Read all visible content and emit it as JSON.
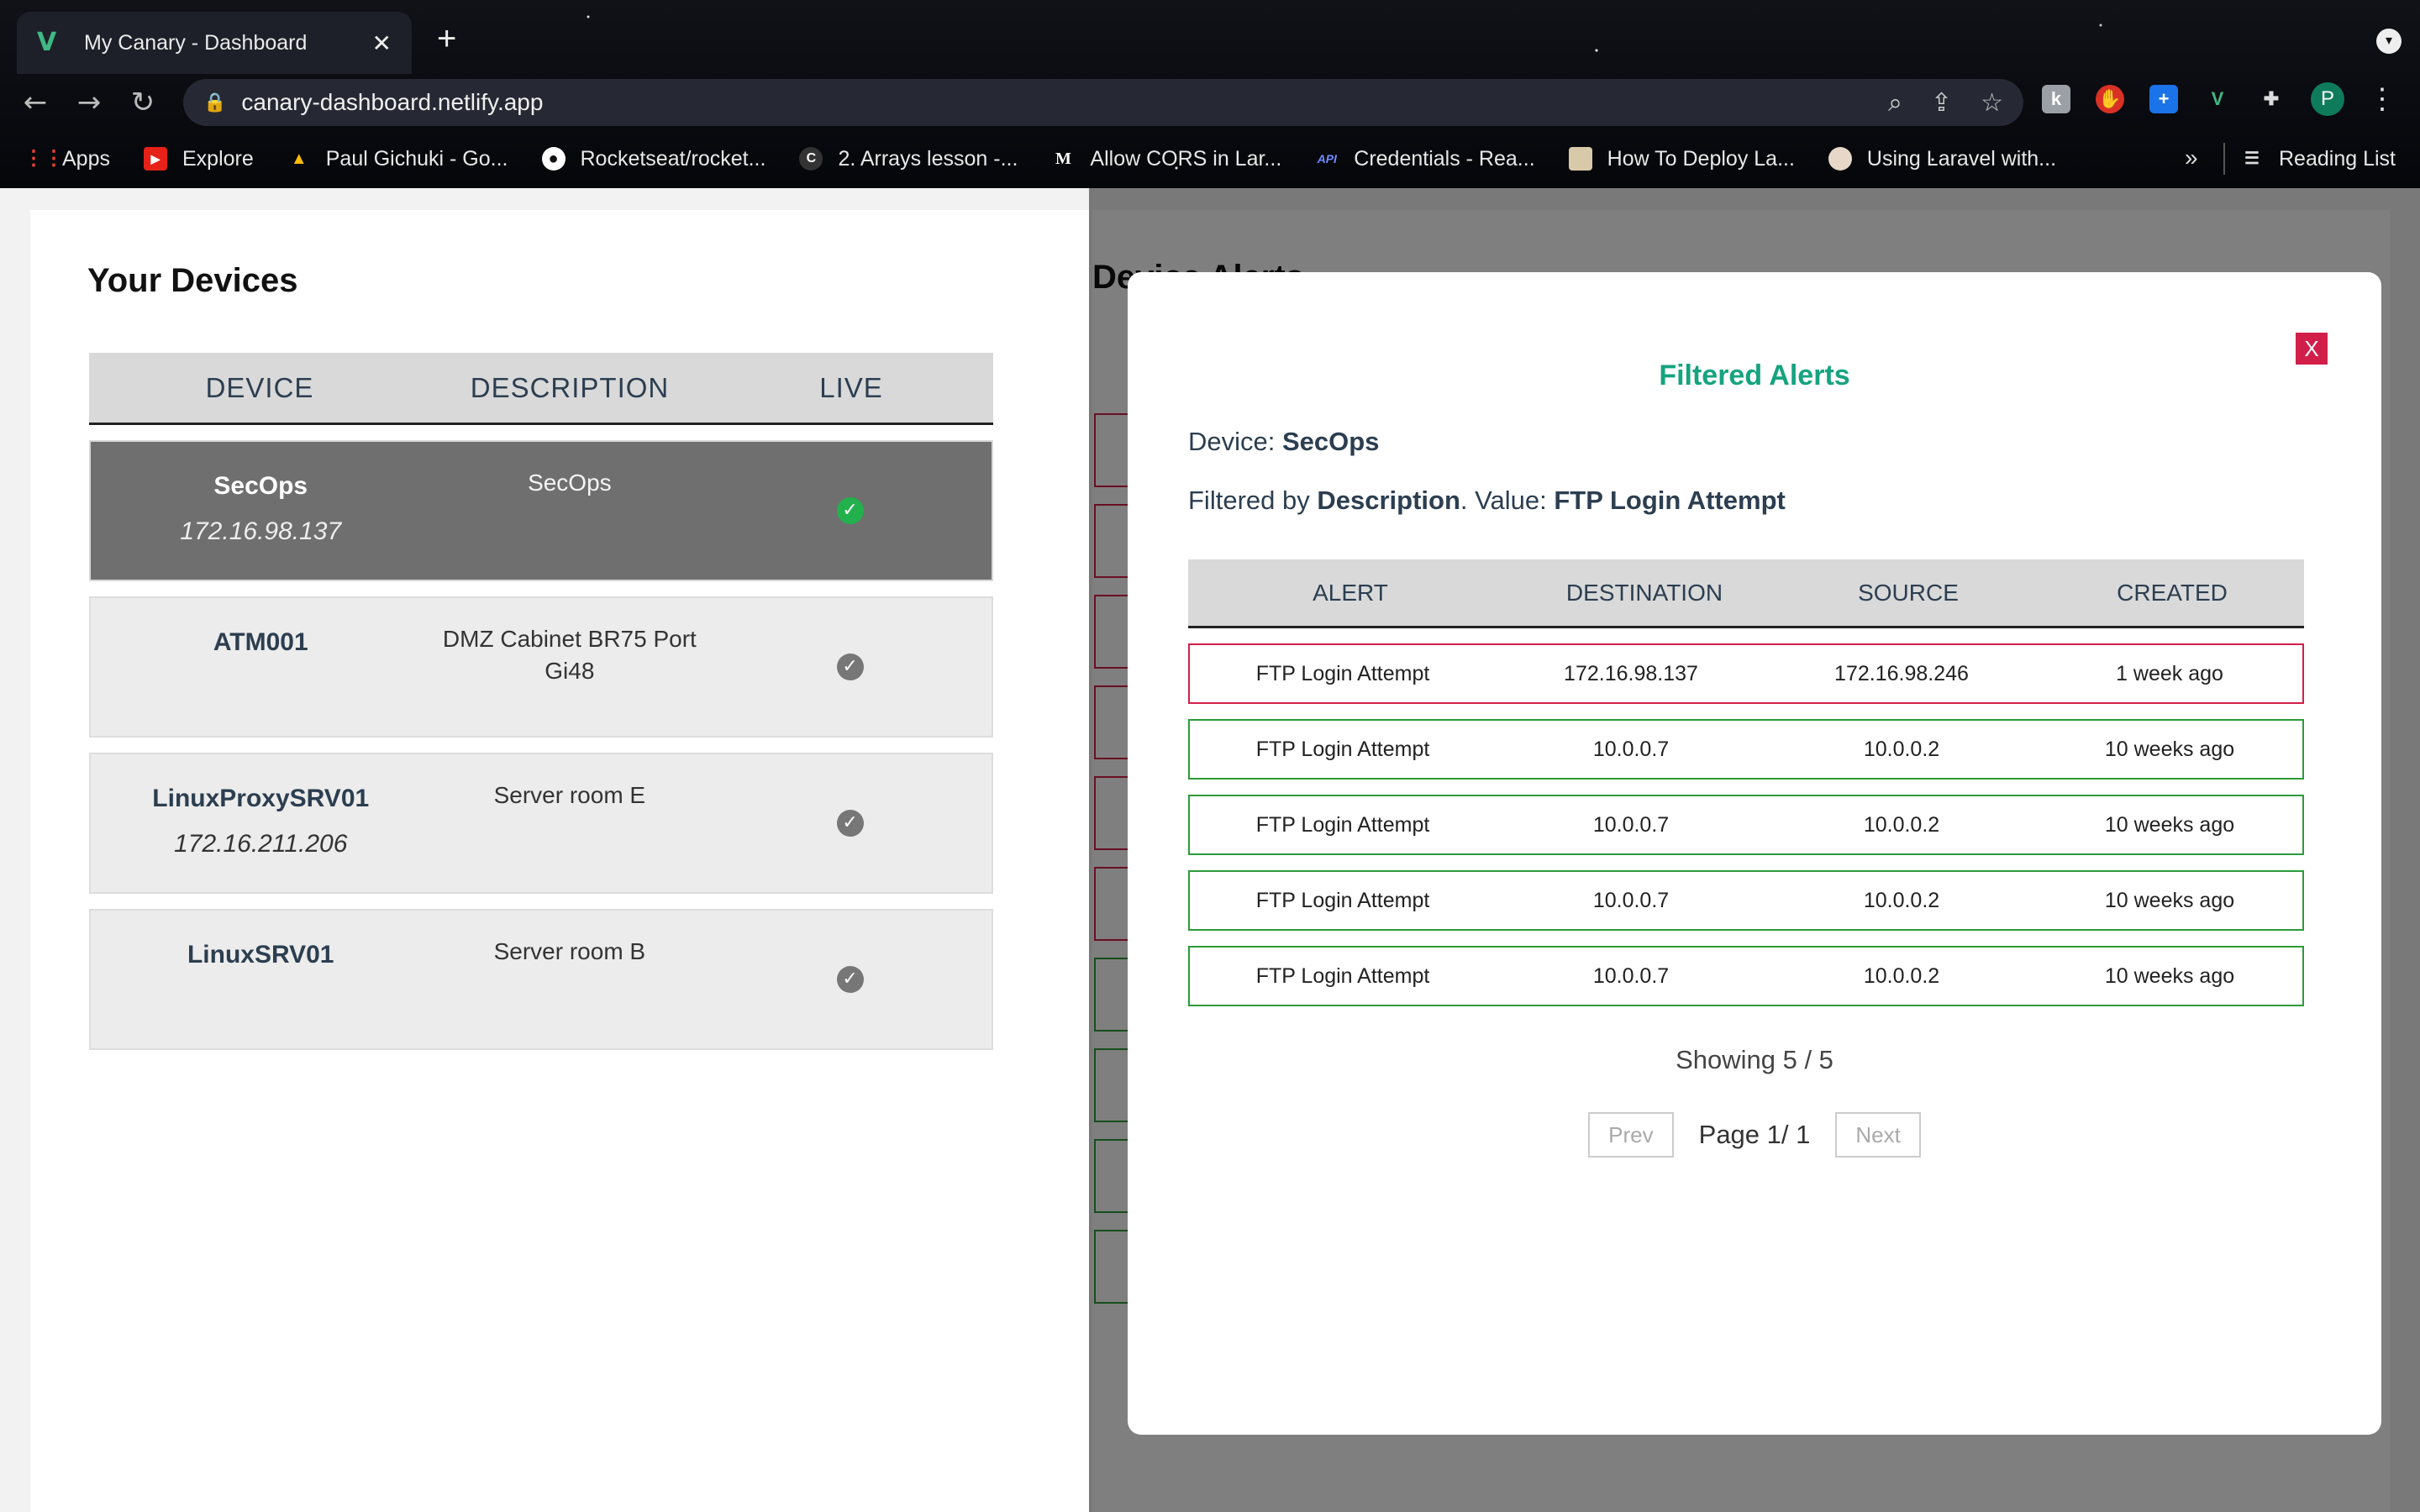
{
  "browser": {
    "tab_title": "My Canary - Dashboard",
    "tab_close": "✕",
    "new_tab": "+",
    "url": "canary-dashboard.netlify.app",
    "profile_initial": "P",
    "bookmarks": [
      {
        "label": "Apps",
        "icon": "apps-grid-icon"
      },
      {
        "label": "Explore",
        "icon": "youtube-icon"
      },
      {
        "label": "Paul Gichuki - Go...",
        "icon": "google-drive-icon"
      },
      {
        "label": "Rocketseat/rocket...",
        "icon": "github-icon"
      },
      {
        "label": "2. Arrays lesson -...",
        "icon": "c-icon"
      },
      {
        "label": "Allow CORS in Lar...",
        "icon": "medium-icon"
      },
      {
        "label": "Credentials - Rea...",
        "icon": "api-icon"
      },
      {
        "label": "How To Deploy La...",
        "icon": "page-icon"
      },
      {
        "label": "Using Laravel with...",
        "icon": "avatar-icon"
      }
    ],
    "more": "»",
    "reading_list": "Reading List"
  },
  "devices": {
    "title": "Your Devices",
    "headers": [
      "DEVICE",
      "DESCRIPTION",
      "LIVE"
    ],
    "rows": [
      {
        "name": "SecOps",
        "ip": "172.16.98.137",
        "description": "SecOps",
        "live": true,
        "selected": true
      },
      {
        "name": "ATM001",
        "ip": "",
        "description": "DMZ Cabinet BR75 Port Gi48",
        "live": false
      },
      {
        "name": "LinuxProxySRV01",
        "ip": "172.16.211.206",
        "description": "Server room E",
        "live": false
      },
      {
        "name": "LinuxSRV01",
        "ip": "",
        "description": "Server room B",
        "live": false
      }
    ]
  },
  "alerts_panel": {
    "title": "Device Alerts"
  },
  "modal": {
    "close": "X",
    "title": "Filtered Alerts",
    "device_label": "Device:",
    "device_value": "SecOps",
    "filtered_by_label": "Filtered by",
    "filtered_by_value": "Description",
    "value_label": ". Value:",
    "value_value": "FTP Login Attempt",
    "headers": [
      "ALERT",
      "DESTINATION",
      "SOURCE",
      "CREATED"
    ],
    "rows": [
      {
        "alert": "FTP Login Attempt",
        "destination": "172.16.98.137",
        "source": "172.16.98.246",
        "created": "1 week ago",
        "status": "red"
      },
      {
        "alert": "FTP Login Attempt",
        "destination": "10.0.0.7",
        "source": "10.0.0.2",
        "created": "10 weeks ago",
        "status": "green"
      },
      {
        "alert": "FTP Login Attempt",
        "destination": "10.0.0.7",
        "source": "10.0.0.2",
        "created": "10 weeks ago",
        "status": "green"
      },
      {
        "alert": "FTP Login Attempt",
        "destination": "10.0.0.7",
        "source": "10.0.0.2",
        "created": "10 weeks ago",
        "status": "green"
      },
      {
        "alert": "FTP Login Attempt",
        "destination": "10.0.0.7",
        "source": "10.0.0.2",
        "created": "10 weeks ago",
        "status": "green"
      }
    ],
    "showing": "Showing 5 / 5",
    "prev": "Prev",
    "page": "Page 1/ 1",
    "next": "Next"
  },
  "colors": {
    "accent": "#16a37f",
    "danger": "#d21f4a",
    "ok": "#2e9b3a"
  }
}
